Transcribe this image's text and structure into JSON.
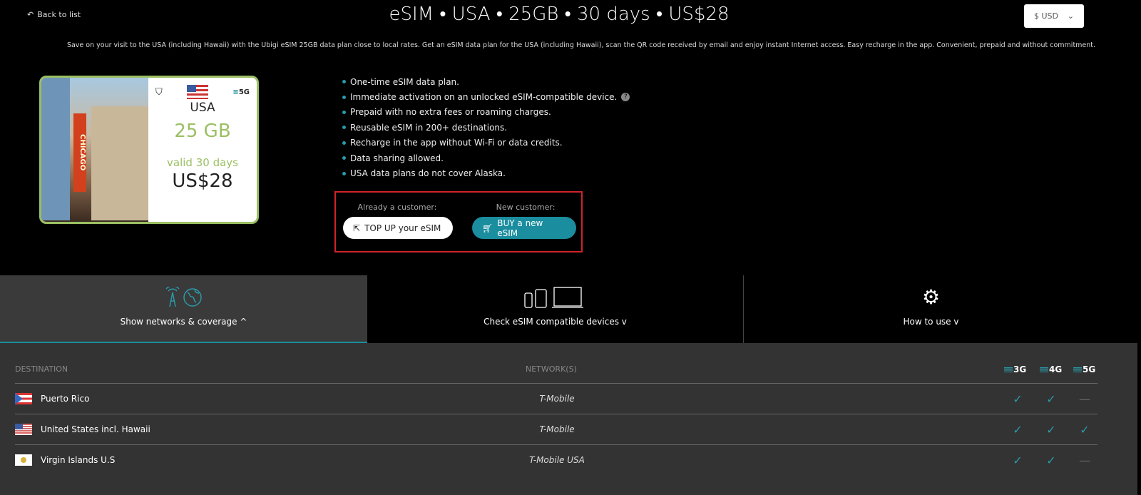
{
  "header": {
    "back_label": "Back to list",
    "title": "eSIM • USA • 25GB • 30 days • US$28",
    "currency": "$ USD"
  },
  "description": "Save on your visit to the USA (including Hawaii) with the Ubigi eSIM 25GB data plan close to local rates. Get an eSIM data plan for the USA (including Hawaii), scan the QR code received by email and enjoy instant Internet access. Easy recharge in the app. Convenient, prepaid and without commitment.",
  "card": {
    "photo_sign": "CHICAGO",
    "network_badge": "5G",
    "country": "USA",
    "data": "25 GB",
    "validity": "valid 30 days",
    "price": "US$28"
  },
  "features": [
    "One-time eSIM data plan.",
    "Immediate activation on an unlocked eSIM-compatible device.",
    "Prepaid with no extra fees or roaming charges.",
    "Reusable eSIM in 200+ destinations.",
    "Recharge in the app without Wi-Fi or data credits.",
    "Data sharing allowed.",
    "USA data plans do not cover Alaska."
  ],
  "cta": {
    "existing_label": "Already a customer:",
    "topup": "TOP UP your eSIM",
    "new_label": "New customer:",
    "buy": "BUY a new eSIM"
  },
  "tabs": [
    {
      "label": "Show networks & coverage",
      "chevron": "^"
    },
    {
      "label": "Check eSIM compatible devices",
      "chevron": "v"
    },
    {
      "label": "How to use",
      "chevron": "v"
    }
  ],
  "table": {
    "headers": {
      "destination": "DESTINATION",
      "network": "NETWORK(S)",
      "g3": "3G",
      "g4": "4G",
      "g5": "5G"
    },
    "rows": [
      {
        "destination": "Puerto Rico",
        "network": "T-Mobile",
        "g3": "✓",
        "g4": "✓",
        "g5": "—"
      },
      {
        "destination": "United States incl. Hawaii",
        "network": "T-Mobile",
        "g3": "✓",
        "g4": "✓",
        "g5": "✓"
      },
      {
        "destination": "Virgin Islands U.S",
        "network": "T-Mobile USA",
        "g3": "✓",
        "g4": "✓",
        "g5": "—"
      }
    ]
  },
  "colors": {
    "accent": "#1a8d9e",
    "card_green": "#9bbf63",
    "highlight_border": "#d0232a"
  }
}
